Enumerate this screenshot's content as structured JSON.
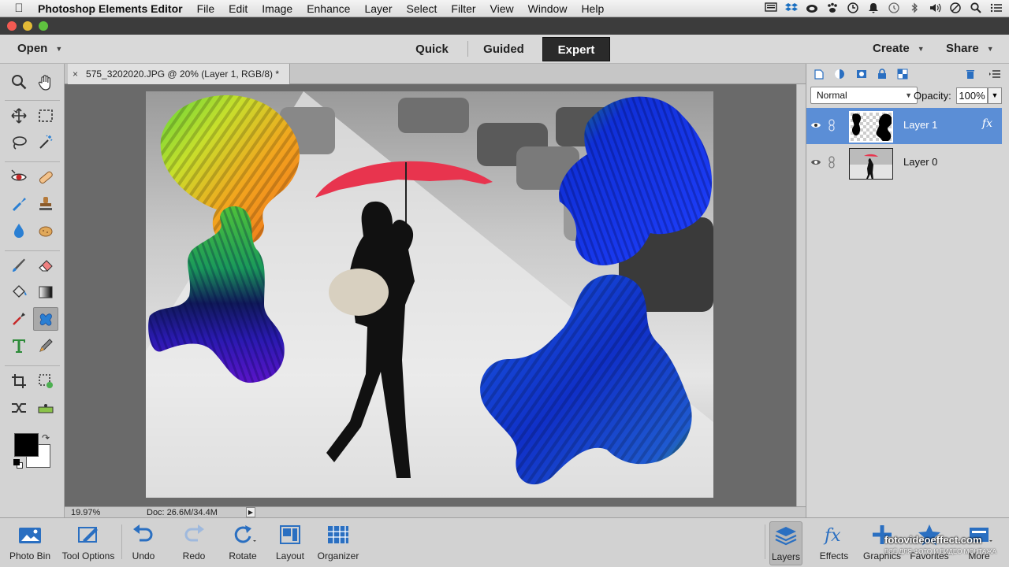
{
  "menubar": {
    "app_name": "Photoshop Elements Editor",
    "items": [
      "File",
      "Edit",
      "Image",
      "Enhance",
      "Layer",
      "Select",
      "Filter",
      "View",
      "Window",
      "Help"
    ],
    "status_icons": [
      "display-icon",
      "dropbox-icon",
      "creative-cloud-icon",
      "paw-icon",
      "clock-icon",
      "notification-icon",
      "time-machine-icon",
      "bluetooth-icon",
      "volume-icon",
      "sync-icon",
      "spotlight-icon",
      "list-icon"
    ]
  },
  "modebar": {
    "open_label": "Open",
    "modes": [
      "Quick",
      "Guided",
      "Expert"
    ],
    "active_mode": "Expert",
    "create_label": "Create",
    "share_label": "Share"
  },
  "document": {
    "tab_close": "×",
    "tab_title": "575_3202020.JPG @ 20% (Layer 1, RGB/8) *"
  },
  "status": {
    "zoom": "19.97%",
    "doc_size": "Doc: 26.6M/34.4M"
  },
  "layers_panel": {
    "blend_mode": "Normal",
    "opacity_label": "Opacity:",
    "opacity_value": "100%",
    "layers": [
      {
        "name": "Layer 1",
        "active": true,
        "fx": "fx"
      },
      {
        "name": "Layer 0",
        "active": false,
        "fx": ""
      }
    ]
  },
  "bottom_bar": {
    "photo_bin": "Photo Bin",
    "tool_options": "Tool Options",
    "undo": "Undo",
    "redo": "Redo",
    "rotate": "Rotate",
    "layout": "Layout",
    "organizer": "Organizer",
    "layers": "Layers",
    "effects": "Effects",
    "graphics": "Graphics",
    "favorites": "Favorites",
    "more": "More"
  },
  "watermark": {
    "text": "fotovideoeffect.com",
    "subtext": "ВСЁ ДЛЯ ФОТО И ВИДЕО МОНТАЖА"
  },
  "colors": {
    "accent_active_layer": "#5b8ed6",
    "expert_button": "#2a2a2a",
    "umbrella": "#e8344e"
  }
}
